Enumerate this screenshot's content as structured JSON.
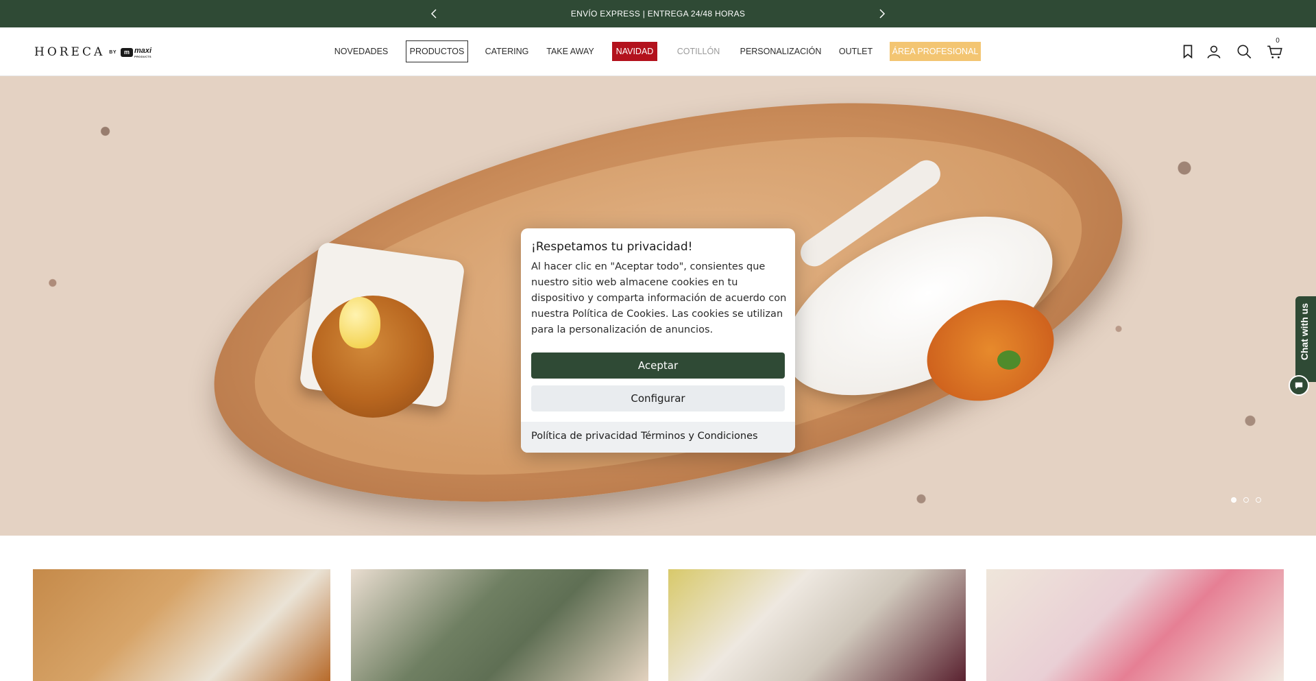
{
  "announcement": {
    "message": "ENVÍO EXPRESS | ENTREGA 24/48 HORAS"
  },
  "header": {
    "logo": {
      "word": "HORECA",
      "by": "BY",
      "brand": "maxi",
      "brand_sub": "PRODUCTS"
    },
    "nav": [
      {
        "label": "NOVEDADES"
      },
      {
        "label": "PRODUCTOS"
      },
      {
        "label": "CATERING"
      },
      {
        "label": "TAKE AWAY"
      },
      {
        "label": "NAVIDAD"
      },
      {
        "label": "COTILLÓN"
      },
      {
        "label": "PERSONALIZACIÓN"
      },
      {
        "label": "OUTLET"
      },
      {
        "label": "ÁREA PROFESIONAL"
      }
    ],
    "icons": [
      "bookmark-icon",
      "account-icon",
      "search-icon",
      "cart-icon"
    ],
    "cart_count": "0"
  },
  "cookie_modal": {
    "title": "¡Respetamos tu privacidad!",
    "body": "Al hacer clic en \"Aceptar todo\", consientes que nuestro sitio web almacene cookies en tu dispositivo y comparta información de acuerdo con nuestra Política de Cookies. Las cookies se utilizan para la personalización de anuncios.",
    "accept_label": "Aceptar",
    "configure_label": "Configurar",
    "privacy_link": "Política de privacidad",
    "terms_link": "Términos y Condiciones"
  },
  "chat": {
    "label": "Chat with us"
  },
  "colors": {
    "brand_green": "#2f4a35",
    "navidad_red": "#b3121d",
    "pro_gold": "#f3c572",
    "muted": "#9a9a9a"
  }
}
